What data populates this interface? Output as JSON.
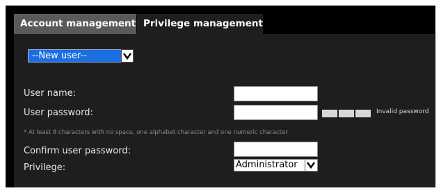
{
  "tabs": [
    {
      "label": "Account management",
      "active": true
    },
    {
      "label": "Privilege management",
      "active": false
    }
  ],
  "user_select": {
    "value": "--New user--"
  },
  "form": {
    "user_name_label": "User name:",
    "user_name_value": "",
    "user_password_label": "User password:",
    "user_password_value": "",
    "password_hint": "* At least 8 characters with no space, one alphabet character and one numeric character",
    "password_strength_text": "Invalid password",
    "confirm_password_label": "Confirm user password:",
    "confirm_password_value": "",
    "privilege_label": "Privilege:",
    "privilege_value": "Administrator"
  },
  "colors": {
    "select_highlight": "#1c6fe0",
    "panel_background": "#1e1e1e",
    "active_tab": "#5a5a5a"
  },
  "icons": [
    "chevron-down-icon"
  ]
}
